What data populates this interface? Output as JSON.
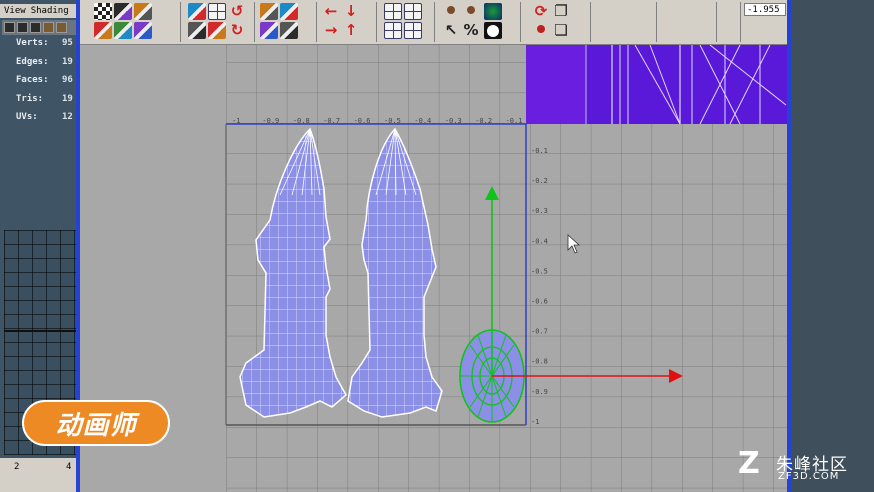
{
  "left_panel": {
    "menu": [
      "View",
      "Shading"
    ],
    "stats": [
      {
        "label": "Verts:",
        "value": "95"
      },
      {
        "label": "Edges:",
        "value": "19"
      },
      {
        "label": "Faces:",
        "value": "96"
      },
      {
        "label": "Tris:",
        "value": "19"
      },
      {
        "label": "UVs:",
        "value": "12"
      }
    ],
    "timeline": [
      "2",
      "4"
    ]
  },
  "toolbar": {
    "coordinate_value": "-1.955",
    "icons": [
      "checker-icon",
      "move-uv-icon",
      "cube-icon",
      "sew-icon",
      "cut-icon",
      "layout-icon",
      "split-icon",
      "unfold-icon",
      "grid-snap-icon",
      "flip-icon",
      "rotate-ccw-icon",
      "rotate-cw-icon",
      "cut-uv-icon",
      "sew-uv-icon",
      "snapshot-icon",
      "pin-icon",
      "arrow-left-icon",
      "arrow-right-icon",
      "arrow-down-icon",
      "arrow-up-icon",
      "frame-all-icon",
      "frame-selected-icon",
      "grid-icon",
      "pixel-snap-icon",
      "user-icon",
      "cursor-icon",
      "user-alt-icon",
      "percent-icon",
      "shaded-uv-icon",
      "white-circle-icon",
      "refresh-icon",
      "user-red-icon",
      "copy-icon",
      "paste-icon"
    ]
  },
  "uv_editor": {
    "top_ruler_labels": [
      "-1",
      "-0.9",
      "-0.8",
      "-0.7",
      "-0.6",
      "-0.5",
      "-0.4",
      "-0.3",
      "-0.2",
      "-0.1"
    ],
    "side_ruler_labels": [
      "-0.1",
      "-0.2",
      "-0.3",
      "-0.4",
      "-0.5",
      "-0.6",
      "-0.7",
      "-0.8",
      "-0.9",
      "-1"
    ]
  },
  "watermark_text": "动画师",
  "site_logo": {
    "mark": "Z",
    "chinese": "朱峰社区",
    "english": "ZF3D.COM"
  },
  "colors": {
    "window_blue": "#2243d6",
    "uv_fill": "#8b8fe6",
    "texture_purple": "#5a18d8",
    "manip_green": "#12c21c",
    "manip_red": "#e01010",
    "badge_orange": "#ee8a24"
  }
}
